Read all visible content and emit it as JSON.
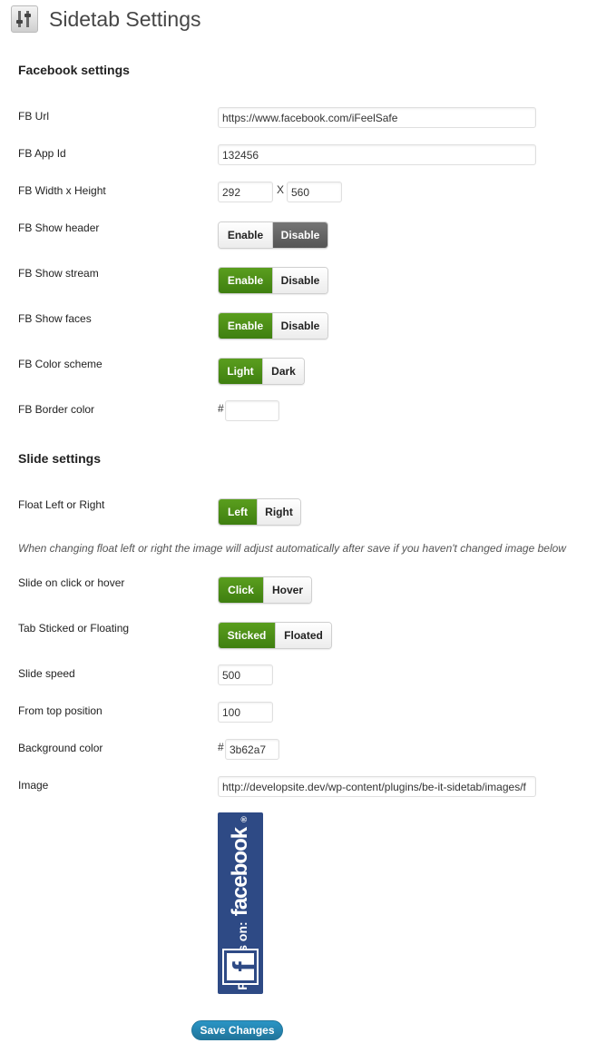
{
  "header": {
    "title": "Sidetab Settings",
    "icon": "sliders-icon"
  },
  "facebook": {
    "heading": "Facebook settings",
    "url": {
      "label": "FB Url",
      "value": "https://www.facebook.com/iFeelSafe"
    },
    "app_id": {
      "label": "FB App Id",
      "value": "132456"
    },
    "size": {
      "label": "FB Width x Height",
      "width": "292",
      "separator": "X",
      "height": "560"
    },
    "show_header": {
      "label": "FB Show header",
      "options": [
        "Enable",
        "Disable"
      ],
      "selected": "Disable"
    },
    "show_stream": {
      "label": "FB Show stream",
      "options": [
        "Enable",
        "Disable"
      ],
      "selected": "Enable"
    },
    "show_faces": {
      "label": "FB Show faces",
      "options": [
        "Enable",
        "Disable"
      ],
      "selected": "Enable"
    },
    "color_scheme": {
      "label": "FB Color scheme",
      "options": [
        "Light",
        "Dark"
      ],
      "selected": "Light"
    },
    "border_color": {
      "label": "FB Border color",
      "hash": "#",
      "value": ""
    }
  },
  "slide": {
    "heading": "Slide settings",
    "float": {
      "label": "Float Left or Right",
      "options": [
        "Left",
        "Right"
      ],
      "selected": "Left"
    },
    "note": "When changing float left or right the image will adjust automatically after save if you haven't changed image below",
    "trigger": {
      "label": "Slide on click or hover",
      "options": [
        "Click",
        "Hover"
      ],
      "selected": "Click"
    },
    "sticky": {
      "label": "Tab Sticked or Floating",
      "options": [
        "Sticked",
        "Floated"
      ],
      "selected": "Sticked"
    },
    "speed": {
      "label": "Slide speed",
      "value": "500"
    },
    "top": {
      "label": "From top position",
      "value": "100"
    },
    "bg_color": {
      "label": "Background color",
      "hash": "#",
      "value": "3b62a7"
    },
    "image": {
      "label": "Image",
      "value": "http://developsite.dev/wp-content/plugins/be-it-sidetab/images/f"
    },
    "preview": {
      "line1": "Find us on:",
      "line2": "facebook",
      "reg": "®",
      "logo": "f"
    }
  },
  "save_label": "Save Changes",
  "colors": {
    "accent_green": "#4a8c17",
    "selected_gray": "#666666",
    "primary_blue": "#21759b",
    "fb_blue": "#2e4a85"
  }
}
